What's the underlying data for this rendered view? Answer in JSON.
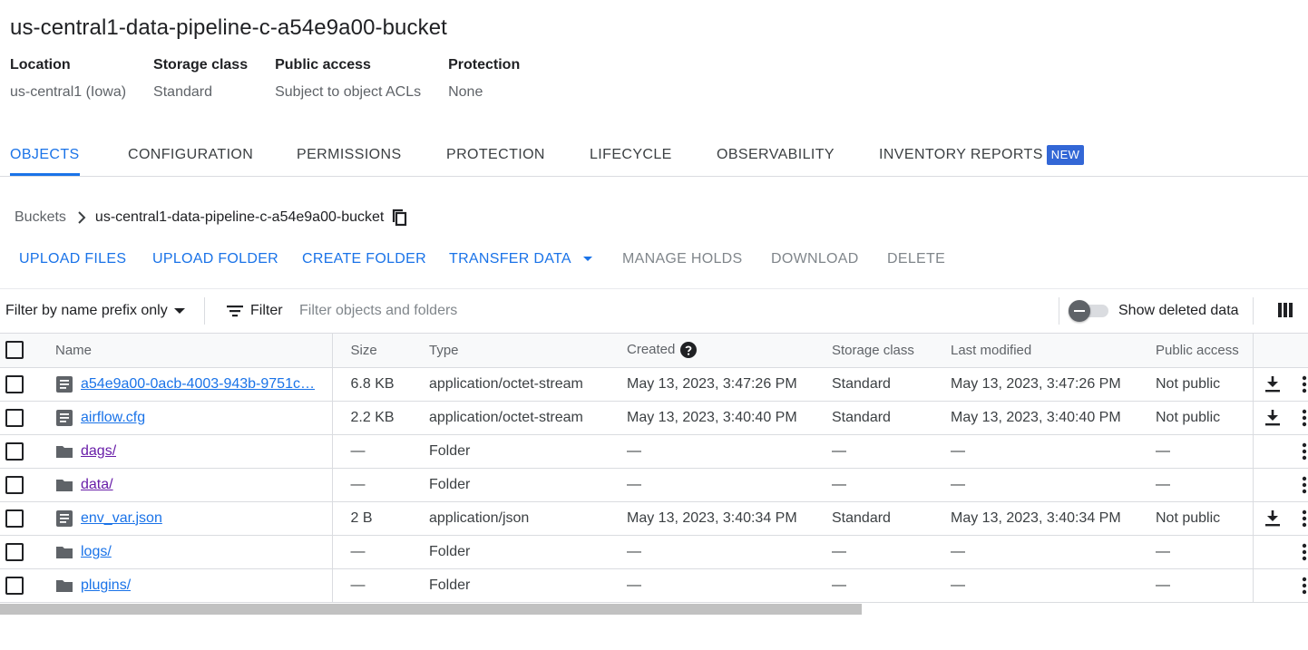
{
  "bucket": {
    "title": "us-central1-data-pipeline-c-a54e9a00-bucket",
    "meta": [
      {
        "label": "Location",
        "value": "us-central1 (Iowa)"
      },
      {
        "label": "Storage class",
        "value": "Standard"
      },
      {
        "label": "Public access",
        "value": "Subject to object ACLs"
      },
      {
        "label": "Protection",
        "value": "None"
      }
    ]
  },
  "tabs": [
    {
      "label": "OBJECTS",
      "active": true
    },
    {
      "label": "CONFIGURATION"
    },
    {
      "label": "PERMISSIONS"
    },
    {
      "label": "PROTECTION"
    },
    {
      "label": "LIFECYCLE"
    },
    {
      "label": "OBSERVABILITY"
    },
    {
      "label": "INVENTORY REPORTS",
      "badge": "NEW"
    }
  ],
  "breadcrumb": {
    "root": "Buckets",
    "current": "us-central1-data-pipeline-c-a54e9a00-bucket"
  },
  "toolbar": {
    "upload_files": "UPLOAD FILES",
    "upload_folder": "UPLOAD FOLDER",
    "create_folder": "CREATE FOLDER",
    "transfer_data": "TRANSFER DATA",
    "manage_holds": "MANAGE HOLDS",
    "download": "DOWNLOAD",
    "delete": "DELETE"
  },
  "filter": {
    "prefix_label": "Filter by name prefix only",
    "filter_label": "Filter",
    "placeholder": "Filter objects and folders",
    "show_deleted_label": "Show deleted data"
  },
  "table": {
    "headers": {
      "name": "Name",
      "size": "Size",
      "type": "Type",
      "created": "Created",
      "storage_class": "Storage class",
      "last_modified": "Last modified",
      "public_access": "Public access"
    },
    "rows": [
      {
        "name": "a54e9a00-0acb-4003-943b-9751c…",
        "kind": "file",
        "size": "6.8 KB",
        "type": "application/octet-stream",
        "created": "May 13, 2023, 3:47:26 PM",
        "storage_class": "Standard",
        "last_modified": "May 13, 2023, 3:47:26 PM",
        "public_access": "Not public"
      },
      {
        "name": "airflow.cfg",
        "kind": "file",
        "size": "2.2 KB",
        "type": "application/octet-stream",
        "created": "May 13, 2023, 3:40:40 PM",
        "storage_class": "Standard",
        "last_modified": "May 13, 2023, 3:40:40 PM",
        "public_access": "Not public"
      },
      {
        "name": "dags/",
        "kind": "folder",
        "visited": true,
        "size": "—",
        "type": "Folder",
        "created": "—",
        "storage_class": "—",
        "last_modified": "—",
        "public_access": "—"
      },
      {
        "name": "data/",
        "kind": "folder",
        "visited": true,
        "size": "—",
        "type": "Folder",
        "created": "—",
        "storage_class": "—",
        "last_modified": "—",
        "public_access": "—"
      },
      {
        "name": "env_var.json",
        "kind": "file",
        "size": "2 B",
        "type": "application/json",
        "created": "May 13, 2023, 3:40:34 PM",
        "storage_class": "Standard",
        "last_modified": "May 13, 2023, 3:40:34 PM",
        "public_access": "Not public"
      },
      {
        "name": "logs/",
        "kind": "folder",
        "size": "—",
        "type": "Folder",
        "created": "—",
        "storage_class": "—",
        "last_modified": "—",
        "public_access": "—"
      },
      {
        "name": "plugins/",
        "kind": "folder",
        "size": "—",
        "type": "Folder",
        "created": "—",
        "storage_class": "—",
        "last_modified": "—",
        "public_access": "—"
      }
    ]
  },
  "colors": {
    "accent": "#1a73e8",
    "visited_link": "#681da8",
    "badge": "#3367d6"
  }
}
